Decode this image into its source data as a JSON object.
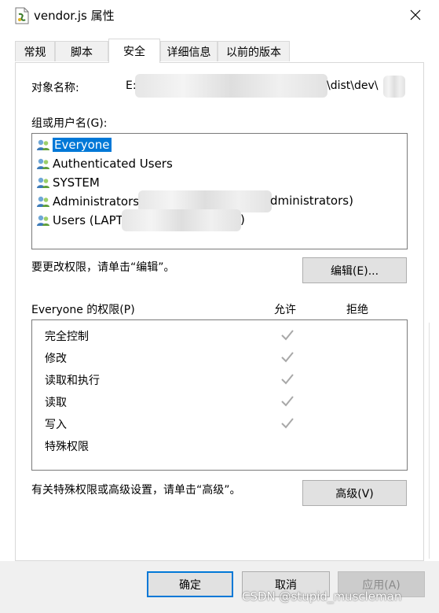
{
  "window": {
    "title": "vendor.js 属性",
    "icon": "js-file-icon",
    "close_icon": "close-icon"
  },
  "tabs": [
    {
      "label": "常规",
      "active": false
    },
    {
      "label": "脚本",
      "active": false
    },
    {
      "label": "安全",
      "active": true
    },
    {
      "label": "详细信息",
      "active": false
    },
    {
      "label": "以前的版本",
      "active": false
    }
  ],
  "security": {
    "object_name_label": "对象名称:",
    "object_name_start": "E:",
    "object_name_end": "\\dist\\dev\\",
    "group_label": "组或用户名(G):",
    "users": [
      {
        "name": "Everyone",
        "selected": true
      },
      {
        "name": "Authenticated Users",
        "selected": false
      },
      {
        "name": "SYSTEM",
        "selected": false
      },
      {
        "name": "Administrators",
        "suffix": "dministrators)",
        "selected": false
      },
      {
        "name": "Users (LAPT",
        "suffix": ")",
        "selected": false
      }
    ],
    "change_hint": "要更改权限，请单击“编辑”。",
    "edit_button": "编辑(E)...",
    "permissions_label": "Everyone 的权限(P)",
    "allow_header": "允许",
    "deny_header": "拒绝",
    "permissions": [
      {
        "name": "完全控制",
        "allow": true,
        "deny": false
      },
      {
        "name": "修改",
        "allow": true,
        "deny": false
      },
      {
        "name": "读取和执行",
        "allow": true,
        "deny": false
      },
      {
        "name": "读取",
        "allow": true,
        "deny": false
      },
      {
        "name": "写入",
        "allow": true,
        "deny": false
      },
      {
        "name": "特殊权限",
        "allow": false,
        "deny": false
      }
    ],
    "advanced_hint": "有关特殊权限或高级设置，请单击“高级”。",
    "advanced_button": "高级(V)"
  },
  "footer": {
    "ok": "确定",
    "cancel": "取消",
    "apply": "应用(A)"
  },
  "watermark": "CSDN @stupid_muscleman",
  "colors": {
    "selection": "#0078d7",
    "check": "#a8a8a8",
    "footer_bg": "#f0f0f0"
  }
}
